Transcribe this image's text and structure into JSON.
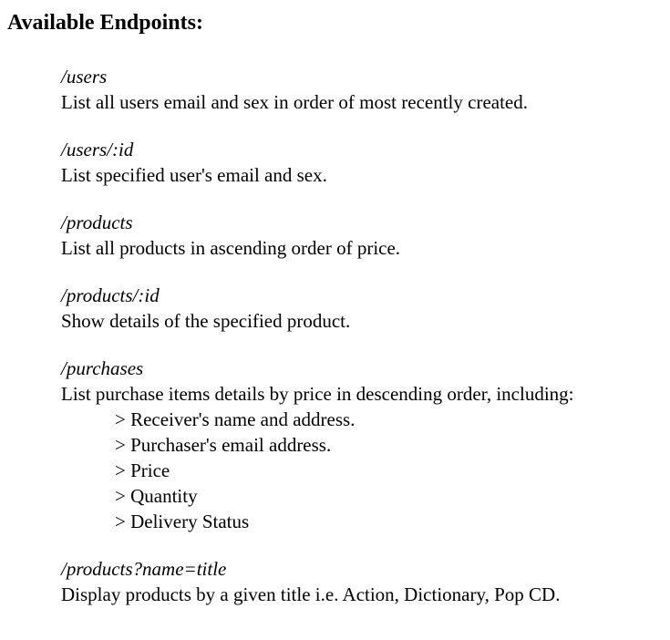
{
  "page": {
    "title": "Available Endpoints:"
  },
  "endpoints": [
    {
      "path": "/users",
      "description": "List all users email and sex in order of most recently created."
    },
    {
      "path": "/users/:id",
      "description": "List specified user's email and sex."
    },
    {
      "path": "/products",
      "description": "List all products in ascending order of price."
    },
    {
      "path": "/products/:id",
      "description": "Show details of the specified product."
    },
    {
      "path": "/purchases",
      "description": "List purchase items details by price in descending order, including:",
      "details": [
        "> Receiver's name and address.",
        "> Purchaser's email address.",
        "> Price",
        "> Quantity",
        "> Delivery Status"
      ]
    },
    {
      "path": "/products?name=title",
      "description": "Display products by a given title i.e. Action, Dictionary, Pop CD."
    }
  ]
}
